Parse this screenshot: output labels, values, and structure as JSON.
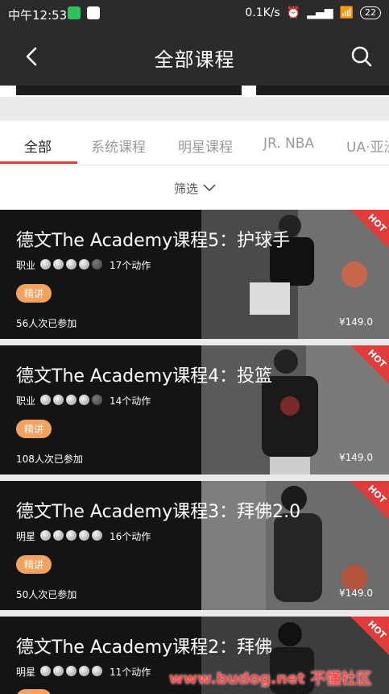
{
  "status_bar": {
    "time": "中午12:53",
    "network_speed": "0.1K/s",
    "battery": "22"
  },
  "header": {
    "title": "全部课程"
  },
  "tabs": [
    {
      "label": "全部"
    },
    {
      "label": "系统课程"
    },
    {
      "label": "明星课程"
    },
    {
      "label": "JR. NBA"
    },
    {
      "label": "UA·亚洲"
    }
  ],
  "filter": {
    "label": "筛选"
  },
  "courses": [
    {
      "title": "德文The Academy课程5：护球手",
      "level": "职业",
      "rating": 4,
      "actions": "17个动作",
      "badge": "精讲",
      "participants": "56人次已参加",
      "price": "¥149.0",
      "hot": "HOT"
    },
    {
      "title": "德文The Academy课程4：投篮",
      "level": "职业",
      "rating": 4,
      "actions": "14个动作",
      "badge": "精讲",
      "participants": "108人次已参加",
      "price": "¥149.0",
      "hot": "HOT"
    },
    {
      "title": "德文The Academy课程3：拜佛2.0",
      "level": "明星",
      "rating": 5,
      "actions": "16个动作",
      "badge": "精讲",
      "participants": "50人次已参加",
      "price": "¥149.0",
      "hot": "HOT"
    },
    {
      "title": "德文The Academy课程2：拜佛",
      "level": "明星",
      "rating": 5,
      "actions": "11个动作",
      "badge": "精讲",
      "participants": "",
      "price": "",
      "hot": "HOT"
    }
  ],
  "watermark": "www.budog.net 不懂社区",
  "colors": {
    "accent": "#e0412e",
    "badge": "#f2a25c",
    "hot": "#e23b3b"
  }
}
